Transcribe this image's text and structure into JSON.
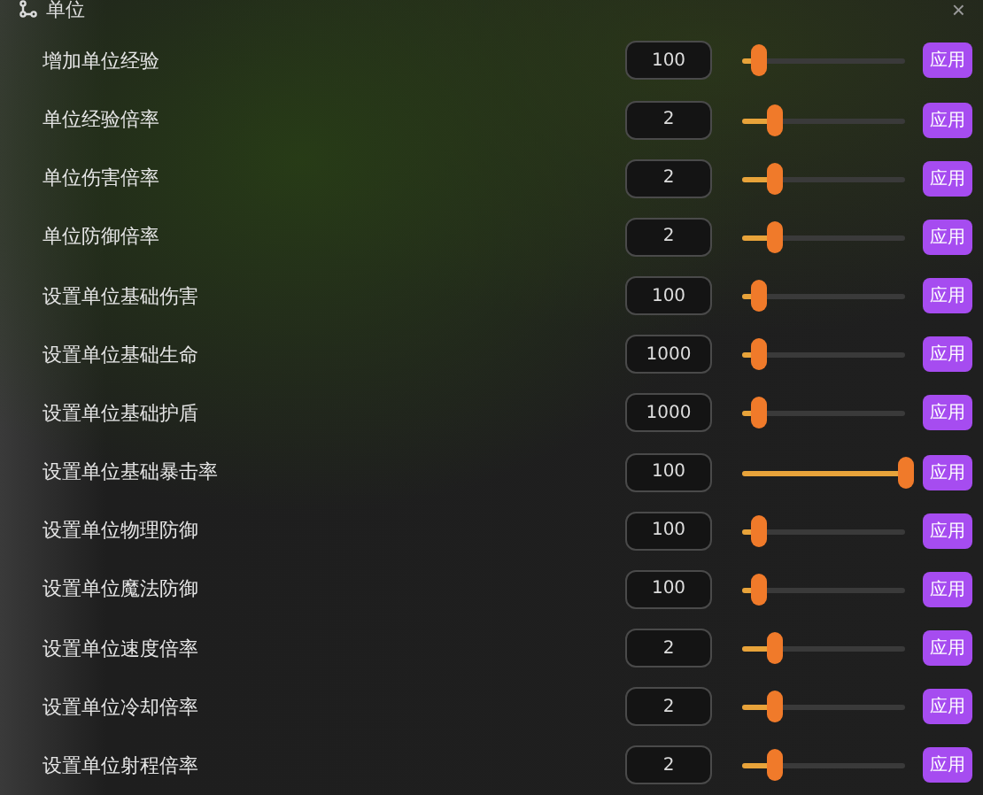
{
  "panel": {
    "title": "单位",
    "close": "×"
  },
  "rows": [
    {
      "label": "增加单位经验",
      "value": "100",
      "level": 0.1,
      "button": "应用"
    },
    {
      "label": "单位经验倍率",
      "value": "2",
      "level": 0.2,
      "button": "应用"
    },
    {
      "label": "单位伤害倍率",
      "value": "2",
      "level": 0.2,
      "button": "应用"
    },
    {
      "label": "单位防御倍率",
      "value": "2",
      "level": 0.2,
      "button": "应用"
    },
    {
      "label": "设置单位基础伤害",
      "value": "100",
      "level": 0.1,
      "button": "应用"
    },
    {
      "label": "设置单位基础生命",
      "value": "1000",
      "level": 0.1,
      "button": "应用"
    },
    {
      "label": "设置单位基础护盾",
      "value": "1000",
      "level": 0.1,
      "button": "应用"
    },
    {
      "label": "设置单位基础暴击率",
      "value": "100",
      "level": 1,
      "button": "应用"
    },
    {
      "label": "设置单位物理防御",
      "value": "100",
      "level": 0.1,
      "button": "应用"
    },
    {
      "label": "设置单位魔法防御",
      "value": "100",
      "level": 0.1,
      "button": "应用"
    },
    {
      "label": "设置单位速度倍率",
      "value": "2",
      "level": 0.2,
      "button": "应用"
    },
    {
      "label": "设置单位冷却倍率",
      "value": "2",
      "level": 0.2,
      "button": "应用"
    },
    {
      "label": "设置单位射程倍率",
      "value": "2",
      "level": 0.2,
      "button": "应用"
    }
  ]
}
